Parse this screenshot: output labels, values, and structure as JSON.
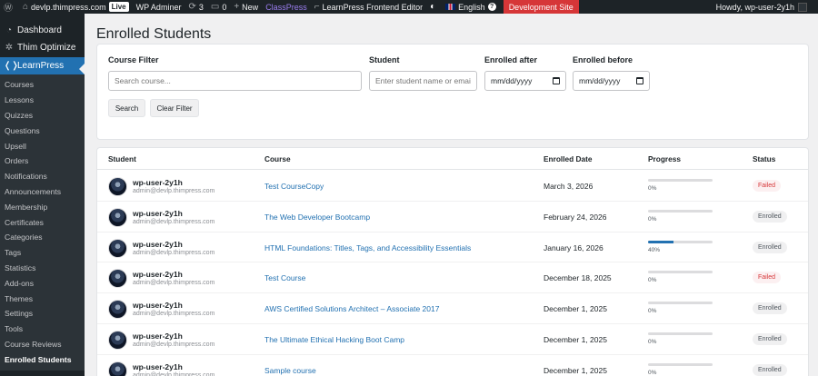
{
  "adminbar": {
    "site": "devlp.thimpress.com",
    "live": "Live",
    "admin": "WP Adminer",
    "updates": "3",
    "comments": "0",
    "new": "New",
    "classpress": "ClassPress",
    "editor": "LearnPress Frontend Editor",
    "language": "English",
    "dev_site": "Development Site",
    "howdy": "Howdy, wp-user-2y1h"
  },
  "sidebar": {
    "top": [
      {
        "label": "Dashboard",
        "icon": "dashboard-icon"
      },
      {
        "label": "Thim Optimize",
        "icon": "gear-icon"
      },
      {
        "label": "LearnPress",
        "icon": "learnpress-icon"
      }
    ],
    "sub": [
      "Courses",
      "Lessons",
      "Quizzes",
      "Questions",
      "Upsell",
      "Orders",
      "Notifications",
      "Announcements",
      "Membership",
      "Certificates",
      "Categories",
      "Tags",
      "Statistics",
      "Add-ons",
      "Themes",
      "Settings",
      "Tools",
      "Course Reviews",
      "Enrolled Students"
    ]
  },
  "page": {
    "title": "Enrolled Students"
  },
  "filters": {
    "course_label": "Course Filter",
    "course_placeholder": "Search course...",
    "student_label": "Student",
    "student_placeholder": "Enter student name or email",
    "after_label": "Enrolled after",
    "before_label": "Enrolled before",
    "date_placeholder": "mm/dd/yyyy",
    "search_btn": "Search",
    "clear_btn": "Clear Filter"
  },
  "table": {
    "headers": {
      "student": "Student",
      "course": "Course",
      "date": "Enrolled Date",
      "progress": "Progress",
      "status": "Status"
    },
    "rows": [
      {
        "name": "wp-user-2y1h",
        "email": "admin@devlp.thimpress.com",
        "course": "Test CourseCopy",
        "date": "March 3, 2026",
        "progress": 0,
        "progress_text": "0%",
        "status": "Failed",
        "status_class": "failed"
      },
      {
        "name": "wp-user-2y1h",
        "email": "admin@devlp.thimpress.com",
        "course": "The Web Developer Bootcamp",
        "date": "February 24, 2026",
        "progress": 0,
        "progress_text": "0%",
        "status": "Enrolled",
        "status_class": "enrolled"
      },
      {
        "name": "wp-user-2y1h",
        "email": "admin@devlp.thimpress.com",
        "course": "HTML Foundations: Titles, Tags, and Accessibility Essentials",
        "date": "January 16, 2026",
        "progress": 40,
        "progress_text": "40%",
        "status": "Enrolled",
        "status_class": "enrolled"
      },
      {
        "name": "wp-user-2y1h",
        "email": "admin@devlp.thimpress.com",
        "course": "Test Course",
        "date": "December 18, 2025",
        "progress": 0,
        "progress_text": "0%",
        "status": "Failed",
        "status_class": "failed"
      },
      {
        "name": "wp-user-2y1h",
        "email": "admin@devlp.thimpress.com",
        "course": "AWS Certified Solutions Architect – Associate 2017",
        "date": "December 1, 2025",
        "progress": 0,
        "progress_text": "0%",
        "status": "Enrolled",
        "status_class": "enrolled"
      },
      {
        "name": "wp-user-2y1h",
        "email": "admin@devlp.thimpress.com",
        "course": "The Ultimate Ethical Hacking Boot Camp",
        "date": "December 1, 2025",
        "progress": 0,
        "progress_text": "0%",
        "status": "Enrolled",
        "status_class": "enrolled"
      },
      {
        "name": "wp-user-2y1h",
        "email": "admin@devlp.thimpress.com",
        "course": "Sample course",
        "date": "December 1, 2025",
        "progress": 0,
        "progress_text": "0%",
        "status": "Enrolled",
        "status_class": "enrolled"
      }
    ]
  }
}
